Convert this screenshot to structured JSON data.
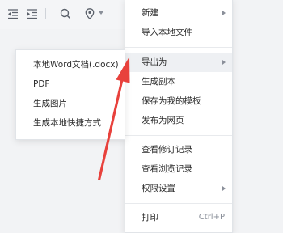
{
  "toolbar": {
    "icons": [
      "outdent-icon",
      "indent-icon",
      "search-icon",
      "location-pin-icon"
    ]
  },
  "menu": {
    "items": [
      {
        "label": "新建",
        "has_submenu": true
      },
      {
        "label": "导入本地文件"
      },
      {
        "label": "导出为",
        "has_submenu": true,
        "active": true
      },
      {
        "label": "生成副本"
      },
      {
        "label": "保存为我的模板"
      },
      {
        "label": "发布为网页"
      },
      {
        "label": "查看修订记录"
      },
      {
        "label": "查看浏览记录"
      },
      {
        "label": "权限设置",
        "has_submenu": true
      },
      {
        "label": "打印",
        "shortcut": "Ctrl+P"
      }
    ]
  },
  "submenu": {
    "items": [
      {
        "label": "本地Word文档(.docx)"
      },
      {
        "label": "PDF"
      },
      {
        "label": "生成图片"
      },
      {
        "label": "生成本地快捷方式"
      }
    ]
  },
  "colors": {
    "annotation_arrow": "#e8413c",
    "active_row": "#eef0f3"
  }
}
